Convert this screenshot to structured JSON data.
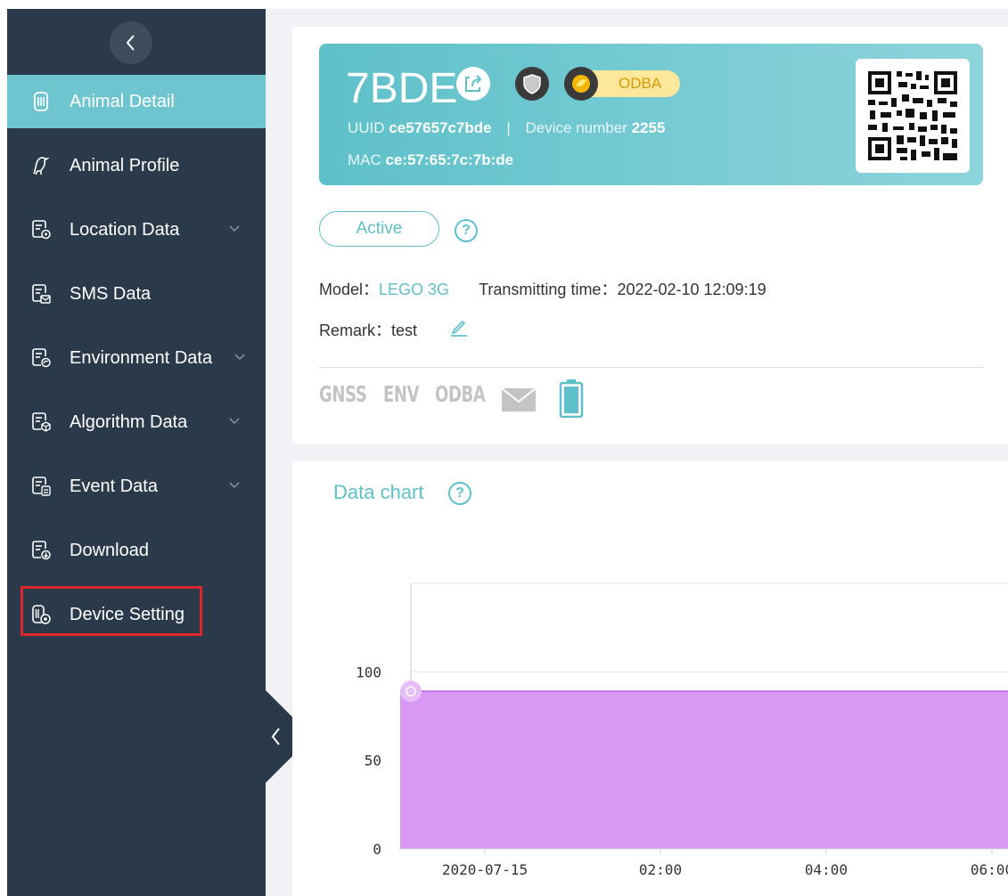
{
  "sidebar": {
    "collapse_icon": "chevron-left-icon",
    "items": [
      {
        "label": "Animal Detail",
        "icon": "device-icon",
        "active": true,
        "expandable": false
      },
      {
        "label": "Animal Profile",
        "icon": "bird-icon",
        "active": false,
        "expandable": false
      },
      {
        "label": "Location Data",
        "icon": "document-location-icon",
        "active": false,
        "expandable": true
      },
      {
        "label": "SMS Data",
        "icon": "document-message-icon",
        "active": false,
        "expandable": false
      },
      {
        "label": "Environment Data",
        "icon": "document-environment-icon",
        "active": false,
        "expandable": true
      },
      {
        "label": "Algorithm Data",
        "icon": "document-algorithm-icon",
        "active": false,
        "expandable": true
      },
      {
        "label": "Event Data",
        "icon": "document-event-icon",
        "active": false,
        "expandable": true
      },
      {
        "label": "Download",
        "icon": "document-download-icon",
        "active": false,
        "expandable": false
      },
      {
        "label": "Device Setting",
        "icon": "device-setting-icon",
        "active": false,
        "expandable": false,
        "highlighted": true
      }
    ]
  },
  "device": {
    "name": "7BDE",
    "odba_badge": "ODBA",
    "uuid_label": "UUID",
    "uuid": "ce57657c7bde",
    "separator": "|",
    "device_number_label": "Device number",
    "device_number": "2255",
    "mac_label": "MAC",
    "mac": "ce:57:65:7c:7b:de"
  },
  "status": {
    "label": "Active",
    "help": "?"
  },
  "info": {
    "model_label": "Model：",
    "model": "LEGO 3G",
    "transmitting_label": "Transmitting time：",
    "transmitting_time": "2022-02-10 12:09:19",
    "remark_label": "Remark：",
    "remark": "test"
  },
  "sensors": [
    "GNSS",
    "ENV",
    "ODBA"
  ],
  "chart_title": "Data chart",
  "chart_help": "?",
  "colors": {
    "sidebar_bg": "#2b3a4a",
    "accent": "#5ec0c9",
    "area_fill": "#d899f5",
    "area_line": "#c277ea",
    "highlight": "#e1252d"
  },
  "chart_data": {
    "type": "area",
    "title": "Data chart",
    "xlabel": "",
    "ylabel": "",
    "x_ticks": [
      "2020-07-15",
      "02:00",
      "04:00",
      "06:00"
    ],
    "y_ticks": [
      0,
      50,
      100
    ],
    "ylim": [
      0,
      150
    ],
    "grid": true,
    "series": [
      {
        "x": [
          0,
          0.17,
          0.93,
          1.02,
          1.1,
          1.88,
          1.96,
          2.06,
          2.14,
          2.2,
          2.28,
          2.36,
          2.44,
          2.5,
          2.58,
          2.64,
          2.72,
          3.8
        ],
        "values": [
          89,
          89,
          89,
          80,
          89,
          89,
          82,
          89,
          80,
          80,
          89,
          82,
          89,
          82,
          89,
          82,
          89,
          89
        ]
      }
    ]
  }
}
